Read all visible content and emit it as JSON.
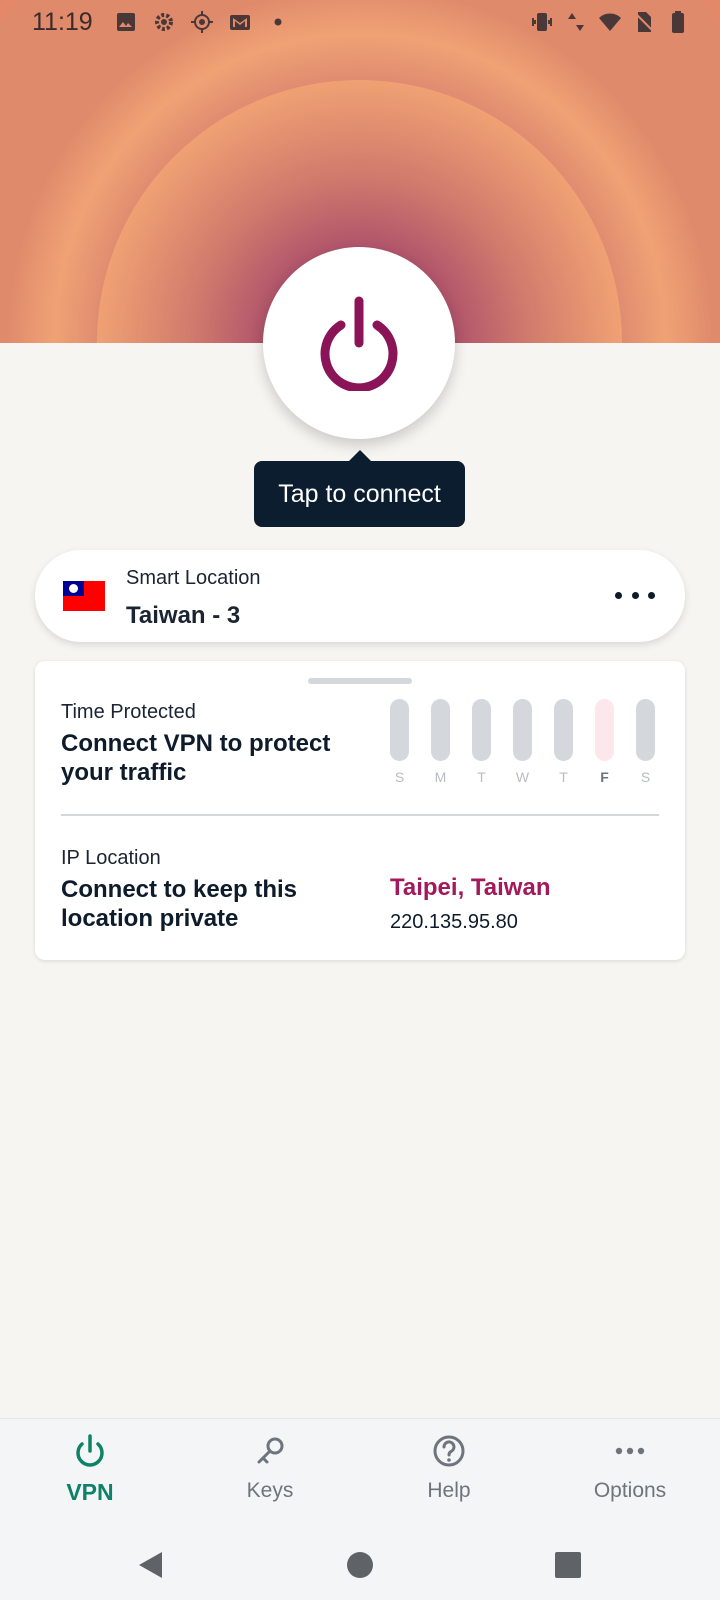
{
  "status_bar": {
    "time": "11:19",
    "left_icons": [
      "image-icon",
      "settings-icon",
      "location-target-icon",
      "gmail-icon",
      "dot-icon"
    ],
    "right_icons": [
      "vibrate-icon",
      "data-arrows-icon",
      "wifi-icon",
      "no-sim-icon",
      "battery-icon"
    ]
  },
  "connect": {
    "tooltip": "Tap to connect",
    "power_color": "#8b1458"
  },
  "location": {
    "subtitle": "Smart Location",
    "name": "Taiwan - 3"
  },
  "time_protected": {
    "label": "Time Protected",
    "message": "Connect VPN to protect your traffic",
    "days": [
      {
        "letter": "S",
        "today": false
      },
      {
        "letter": "M",
        "today": false
      },
      {
        "letter": "T",
        "today": false
      },
      {
        "letter": "W",
        "today": false
      },
      {
        "letter": "T",
        "today": false
      },
      {
        "letter": "F",
        "today": true
      },
      {
        "letter": "S",
        "today": false
      }
    ]
  },
  "ip_location": {
    "label": "IP Location",
    "message": "Connect to keep this location private",
    "city": "Taipei, Taiwan",
    "ip": "220.135.95.80"
  },
  "bottom_nav": {
    "items": [
      {
        "label": "VPN",
        "icon": "power-icon",
        "active": true
      },
      {
        "label": "Keys",
        "icon": "key-icon",
        "active": false
      },
      {
        "label": "Help",
        "icon": "help-icon",
        "active": false
      },
      {
        "label": "Options",
        "icon": "more-icon",
        "active": false
      }
    ]
  },
  "colors": {
    "accent_green": "#0e8268",
    "accent_magenta": "#a3195b",
    "tooltip_bg": "#0b1d2e"
  }
}
